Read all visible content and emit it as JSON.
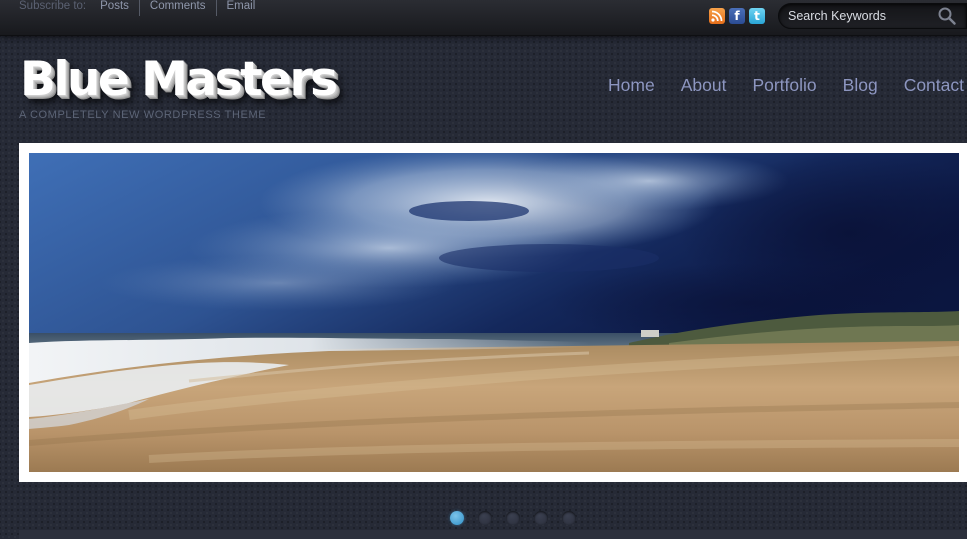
{
  "topbar": {
    "subscribe_label": "Subscribe to:",
    "links": [
      {
        "label": "Posts"
      },
      {
        "label": "Comments"
      },
      {
        "label": "Email"
      }
    ],
    "social_icons": [
      "rss-icon",
      "facebook-icon",
      "twitter-icon"
    ],
    "search": {
      "placeholder": "Search Keywords"
    }
  },
  "header": {
    "logo": "Blue Masters",
    "tagline": "A completely new wordpress theme",
    "nav": [
      {
        "label": "Home"
      },
      {
        "label": "About"
      },
      {
        "label": "Portfolio"
      },
      {
        "label": "Blog"
      },
      {
        "label": "Contact"
      }
    ]
  },
  "slider": {
    "image": "beach-photo",
    "slide_count": 5,
    "active_index": 0
  },
  "colors": {
    "background": "#262a36",
    "nav_link": "#8d96c0",
    "active_dot": "#3d9ad3"
  }
}
